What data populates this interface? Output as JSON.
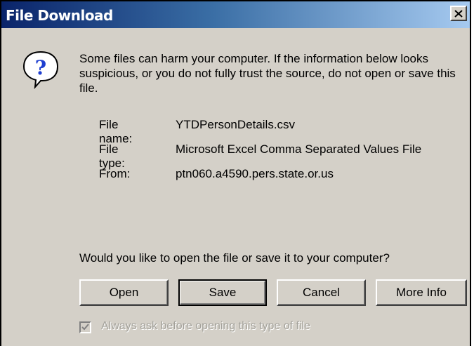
{
  "window": {
    "title": "File Download",
    "close_label": "×"
  },
  "message": {
    "icon": "question-icon",
    "text": "Some files can harm your computer. If the information below looks suspicious, or you do not fully trust the source, do not open or save this file."
  },
  "file": {
    "name_label": "File name:",
    "name_value": "YTDPersonDetails.csv",
    "type_label": "File type:",
    "type_value": "Microsoft Excel Comma Separated Values File",
    "from_label": "From:",
    "from_value": "ptn060.a4590.pers.state.or.us"
  },
  "question": "Would you like to open the file or save it to your computer?",
  "buttons": {
    "open": "Open",
    "save": "Save",
    "cancel": "Cancel",
    "more_info": "More Info"
  },
  "checkbox": {
    "label": "Always ask before opening this type of file",
    "checked": true,
    "disabled": true
  },
  "colors": {
    "dialog_background": "#d4d0c8",
    "title_gradient_start": "#0a246a",
    "title_gradient_end": "#a6caf0",
    "icon_blue": "#1f3fd0"
  }
}
